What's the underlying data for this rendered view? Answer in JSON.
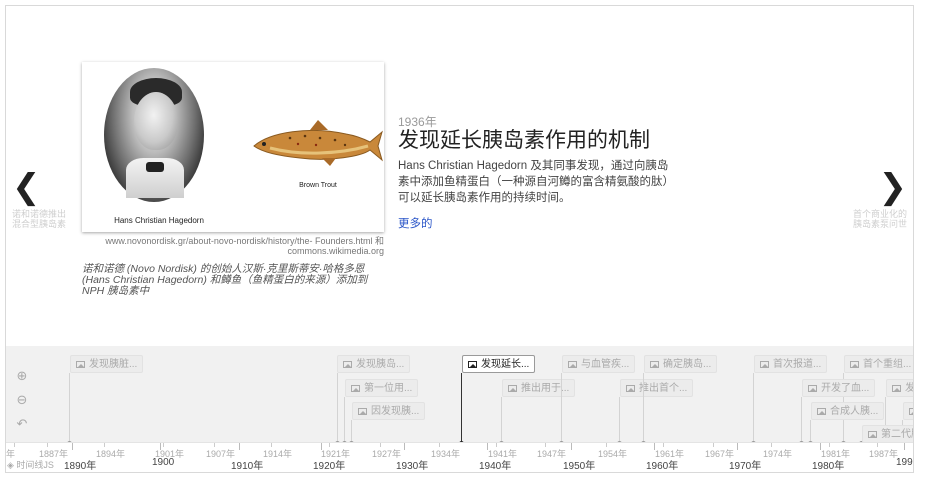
{
  "nav": {
    "prev_arrow": "❮",
    "next_arrow": "❯",
    "prev_hint": "诺和诺德推出混合型胰岛素",
    "next_hint": "首个商业化的胰岛素泵问世"
  },
  "slide": {
    "portrait_caption": "Hans Christian Hagedorn",
    "fish_caption": "Brown Trout",
    "credit_line1": "www.novonordisk.gr/about-novo-nordisk/history/the- Founders.html 和",
    "credit_line2": "commons.wikimedia.org",
    "media_caption": "诺和诺德 (Novo Nordisk) 的创始人汉斯·克里斯蒂安·哈格多恩 (Hans Christian Hagedorn) 和鳟鱼（鱼精蛋白的来源）添加到 NPH 胰岛素中",
    "date": "1936年",
    "title": "发现延长胰岛素作用的机制",
    "body": "Hans Christian Hagedorn 及其同事发现，通过向胰岛素中添加鱼精蛋白（一种源自河鳟的富含精氨酸的肽）可以延长胰岛素作用的持续时间。",
    "more": "更多的"
  },
  "timenav": {
    "zoom_in": "⊕",
    "zoom_out": "⊖",
    "back": "↶",
    "brand": "◈ 时间线JS",
    "flags": [
      {
        "label": "发现胰脏..."
      },
      {
        "label": "发现胰岛..."
      },
      {
        "label": "第一位用..."
      },
      {
        "label": "因发现胰..."
      },
      {
        "label": "发现延长..."
      },
      {
        "label": "推出用于..."
      },
      {
        "label": "与血管疾..."
      },
      {
        "label": "推出首个..."
      },
      {
        "label": "确定胰岛..."
      },
      {
        "label": "首次报道..."
      },
      {
        "label": "首个重组..."
      },
      {
        "label": "开发了血..."
      },
      {
        "label": "发现..."
      },
      {
        "label": "合成人胰..."
      },
      {
        "label": "..."
      },
      {
        "label": "第二代胰..."
      }
    ],
    "minor_labels": [
      "年",
      "1887年",
      "1894年",
      "1901年",
      "1907年",
      "1914年",
      "1921年",
      "1927年",
      "1934年",
      "1941年",
      "1947年",
      "1954年",
      "1961年",
      "1967年",
      "1974年",
      "1981年",
      "1987年"
    ],
    "major_labels": [
      "1890年",
      "1900",
      "1910年",
      "1920年",
      "1930年",
      "1940年",
      "1950年",
      "1960年",
      "1970年",
      "1980年",
      "1990"
    ]
  }
}
